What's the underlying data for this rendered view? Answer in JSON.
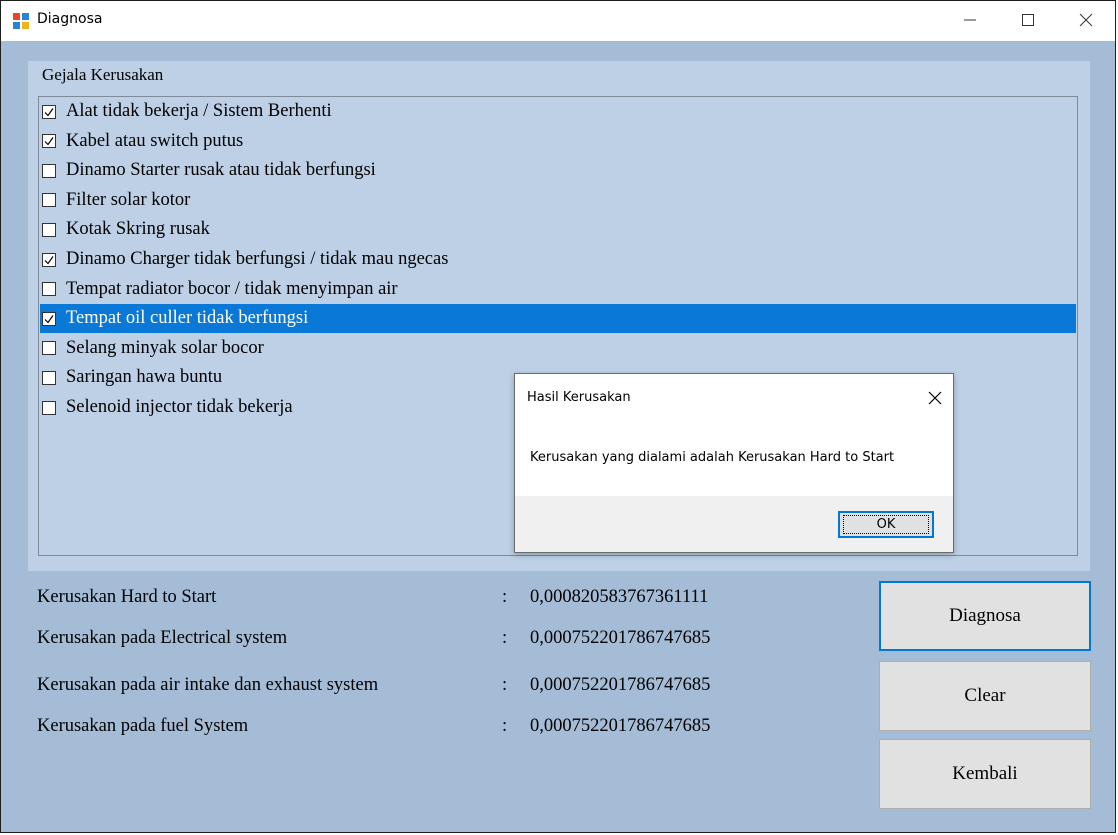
{
  "window": {
    "title": "Diagnosa"
  },
  "colors": {
    "accent": "#0078d7",
    "selection": "#0a78d7",
    "form_bg": "#a5bcd6",
    "group_bg": "#bdd0e6"
  },
  "symptoms": {
    "label": "Gejala Kerusakan",
    "items": [
      {
        "label": "Alat tidak bekerja / Sistem Berhenti",
        "checked": true
      },
      {
        "label": "Kabel atau switch putus",
        "checked": true
      },
      {
        "label": "Dinamo Starter rusak atau tidak berfungsi",
        "checked": false
      },
      {
        "label": "Filter solar kotor",
        "checked": false
      },
      {
        "label": "Kotak Skring rusak",
        "checked": false
      },
      {
        "label": "Dinamo Charger tidak berfungsi / tidak mau ngecas",
        "checked": true
      },
      {
        "label": "Tempat radiator bocor / tidak menyimpan air",
        "checked": false
      },
      {
        "label": "Tempat oil culler tidak berfungsi",
        "checked": true,
        "selected": true
      },
      {
        "label": "Selang minyak solar bocor",
        "checked": false
      },
      {
        "label": "Saringan hawa buntu",
        "checked": false
      },
      {
        "label": "Selenoid injector tidak bekerja",
        "checked": false
      }
    ]
  },
  "results": [
    {
      "label": "Kerusakan Hard to Start",
      "colon": ":",
      "value": "0,000820583767361111"
    },
    {
      "label": "Kerusakan pada Electrical system",
      "colon": ":",
      "value": "0,000752201786747685"
    },
    {
      "label": "Kerusakan pada air intake dan exhaust system",
      "colon": ":",
      "value": "0,000752201786747685"
    },
    {
      "label": "Kerusakan pada fuel System",
      "colon": ":",
      "value": "0,000752201786747685"
    }
  ],
  "buttons": {
    "diagnosa": "Diagnosa",
    "clear": "Clear",
    "kembali": "Kembali"
  },
  "dialog": {
    "title": "Hasil Kerusakan",
    "message": "Kerusakan yang dialami adalah Kerusakan Hard to Start",
    "ok_label": "OK"
  }
}
